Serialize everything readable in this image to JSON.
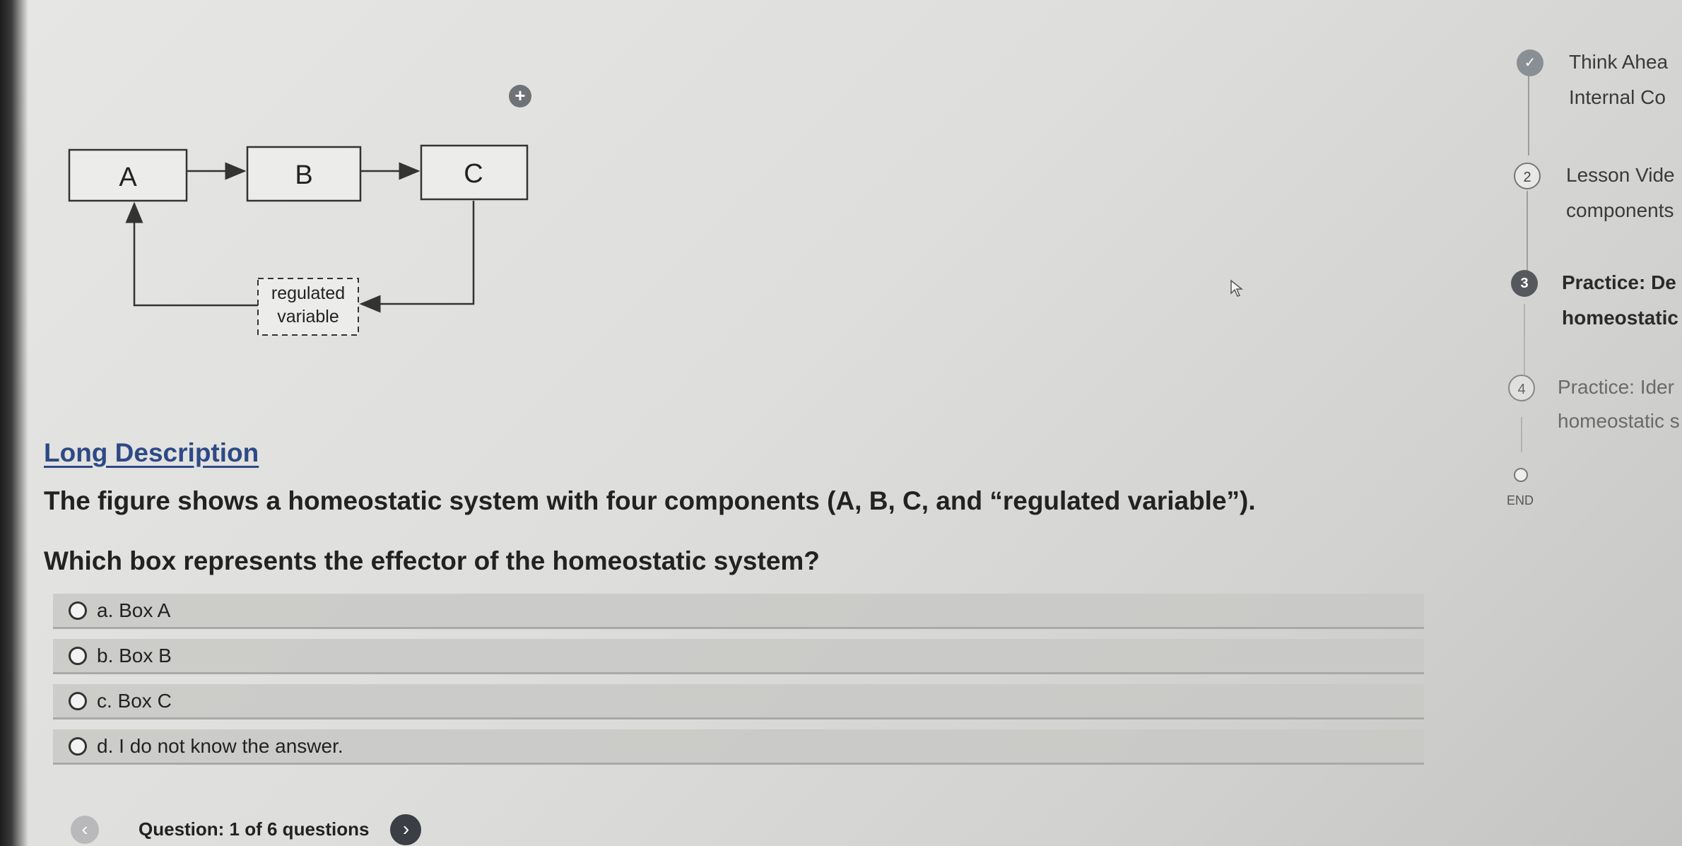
{
  "diagram": {
    "box_a": "A",
    "box_b": "B",
    "box_c": "C",
    "regulated_line1": "regulated",
    "regulated_line2": "variable"
  },
  "content": {
    "long_description_link": "Long Description",
    "description": "The figure shows a homeostatic system with four components (A, B, C, and “regulated variable”).",
    "question": "Which box represents the effector of the homeostatic system?"
  },
  "options": [
    {
      "label": "a. Box A"
    },
    {
      "label": "b. Box B"
    },
    {
      "label": "c. Box C"
    },
    {
      "label": "d. I do not know the answer."
    }
  ],
  "footer": {
    "prev_icon": "‹",
    "question_count": "Question: 1 of 6 questions",
    "next_icon": "›"
  },
  "progress": {
    "steps": [
      {
        "marker": "✓",
        "line1": "Think Ahea",
        "line2": "Internal Co"
      },
      {
        "marker": "2",
        "line1": "Lesson Vide",
        "line2": "components"
      },
      {
        "marker": "3",
        "line1": "Practice: De",
        "line2": "homeostatic"
      },
      {
        "marker": "4",
        "line1": "Practice: Ider",
        "line2": "homeostatic s"
      }
    ],
    "end_label": "END"
  },
  "colors": {
    "link": "#2d4a86",
    "completed_marker": "#8a8f95",
    "active_marker": "#55595e"
  },
  "icons": {
    "plus": "plus-circle-icon",
    "cursor": "mouse-cursor-icon"
  }
}
